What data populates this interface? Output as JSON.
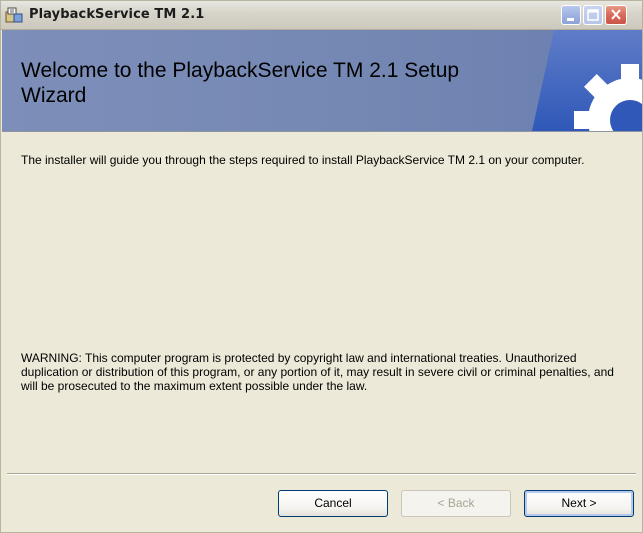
{
  "window": {
    "title": "PlaybackService TM 2.1",
    "icon": "installer-icon"
  },
  "titlebar_buttons": {
    "minimize_icon": "minimize-icon",
    "maximize_icon": "maximize-icon",
    "close_icon": "close-icon"
  },
  "banner": {
    "title": "Welcome to the PlaybackService TM 2.1 Setup Wizard",
    "art_icon": "gear-icon"
  },
  "body": {
    "intro": "The installer will guide you through the steps required to install PlaybackService TM 2.1 on your computer.",
    "warning": "WARNING: This computer program is protected by copyright law and international treaties. Unauthorized duplication or distribution of this program, or any portion of it, may result in severe civil or criminal penalties, and will be prosecuted to the maximum extent possible under the law."
  },
  "buttons": {
    "cancel": "Cancel",
    "back": "< Back",
    "next": "Next >"
  },
  "colors": {
    "banner": "#7487b3",
    "window_bg": "#ece9d8",
    "close_button": "#d7695b"
  }
}
